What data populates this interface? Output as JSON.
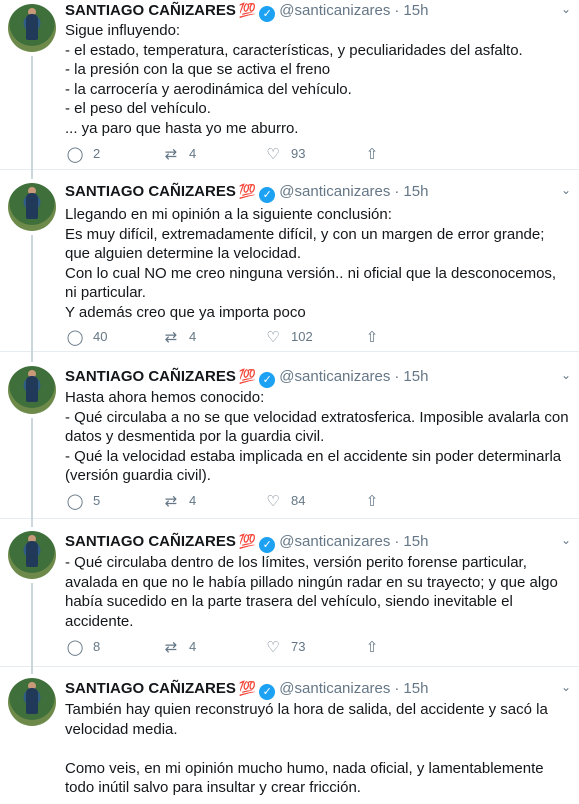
{
  "author": {
    "name": "SANTIAGO CAÑIZARES",
    "emoji": "💯",
    "verified_glyph": "✓",
    "handle": "@santicanizares",
    "separator": "·"
  },
  "icons": {
    "reply": "speech-bubble-icon",
    "retweet": "retweet-icon",
    "like": "heart-icon",
    "share": "share-icon",
    "more": "chevron-down-icon",
    "verified": "verified-badge-icon"
  },
  "glyphs": {
    "reply": "◯",
    "retweet": "⇄",
    "like": "♡",
    "share": "⇧",
    "more": "⌄"
  },
  "colors": {
    "text": "#14171a",
    "muted": "#657786",
    "verified": "#1da1f2",
    "emoji": "#e0245e",
    "divider": "#e6ecf0"
  },
  "tweets": [
    {
      "time": "15h",
      "text": "Sigue influyendo:\n- el estado, temperatura, características, y peculiaridades del asfalto.\n- la presión con la que se activa el freno\n- la carrocería y aerodinámica del vehículo.\n- el peso del vehículo.\n... ya paro que hasta yo me aburro.",
      "replies": "2",
      "retweets": "4",
      "likes": "93"
    },
    {
      "time": "15h",
      "text": "Llegando en mi opinión a la siguiente conclusión:\nEs muy difícil, extremadamente difícil, y con un margen de error grande; que alguien determine la velocidad.\nCon lo cual NO me creo ninguna versión.. ni oficial que la desconocemos, ni particular.\nY además creo que ya importa poco",
      "replies": "40",
      "retweets": "4",
      "likes": "102"
    },
    {
      "time": "15h",
      "text": "Hasta ahora hemos conocido:\n- Qué circulaba a no se que velocidad extratosferica. Imposible avalarla con datos y desmentida por la guardia civil.\n- Qué la velocidad estaba implicada en el accidente sin poder determinarla (versión guardia civil).",
      "replies": "5",
      "retweets": "4",
      "likes": "84"
    },
    {
      "time": "15h",
      "text": "- Qué circulaba dentro de los límites, versión perito forense particular, avalada en que no le había pillado ningún radar en su trayecto; y que algo había sucedido en la parte trasera del vehículo, siendo inevitable el accidente.",
      "replies": "8",
      "retweets": "4",
      "likes": "73"
    },
    {
      "time": "15h",
      "text": "También hay quien reconstruyó la hora de salida, del accidente y sacó la velocidad media.\n\nComo veis, en mi opinión mucho humo, nada oficial, y lamentablemente todo inútil salvo para insultar y crear fricción.",
      "replies": "",
      "retweets": "",
      "likes": ""
    }
  ]
}
